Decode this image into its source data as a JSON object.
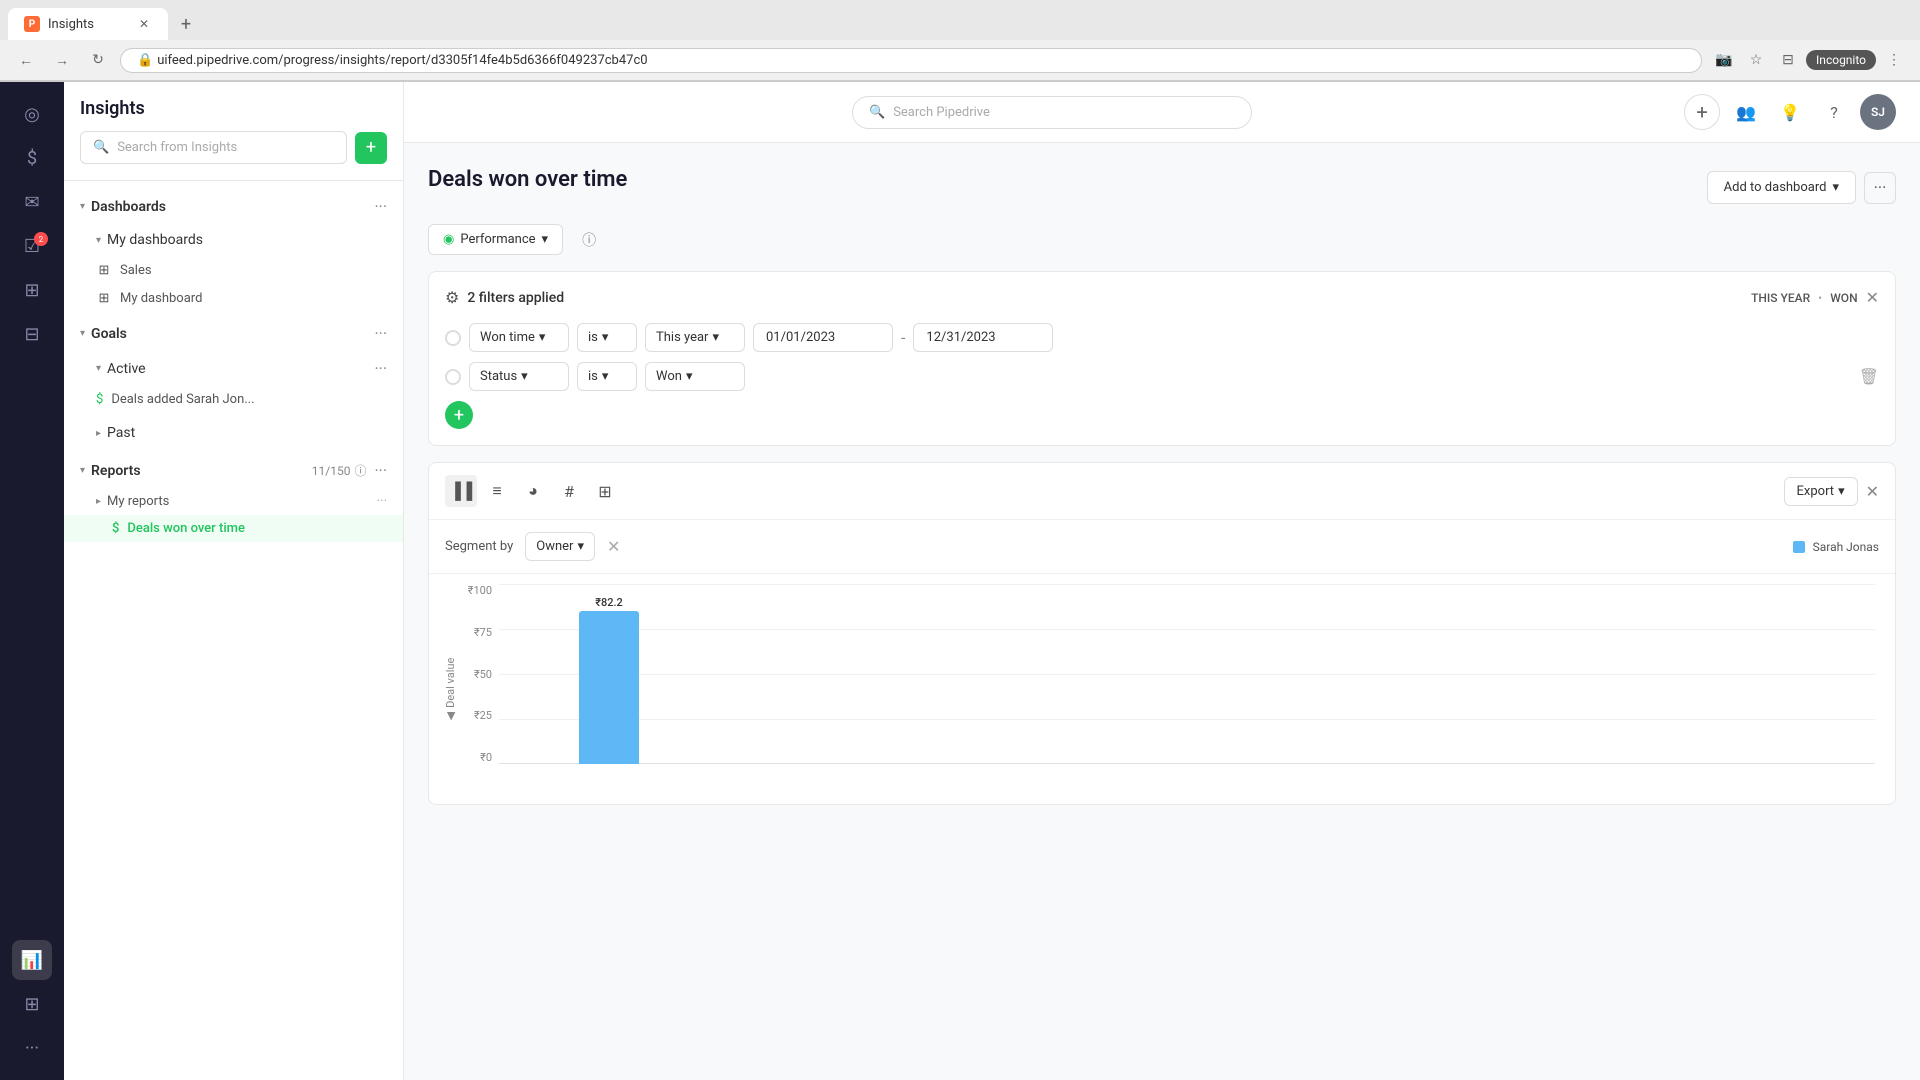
{
  "browser": {
    "tab_title": "Insights",
    "tab_favicon": "P",
    "url": "uifeed.pipedrive.com/progress/insights/report/d3305f14fe4b5d6366f049237cb47c0",
    "new_tab_label": "+",
    "incognito_label": "Incognito"
  },
  "header": {
    "app_title": "Insights",
    "search_placeholder": "Search Pipedrive",
    "add_label": "+",
    "avatar_label": "SJ"
  },
  "sidebar": {
    "search_placeholder": "Search from Insights",
    "add_btn_label": "+",
    "dashboards_label": "Dashboards",
    "my_dashboards_label": "My dashboards",
    "sales_label": "Sales",
    "my_dashboard_label": "My dashboard",
    "goals_label": "Goals",
    "active_label": "Active",
    "deals_added_label": "Deals added Sarah Jon...",
    "past_label": "Past",
    "reports_label": "Reports",
    "reports_count": "11/150",
    "my_reports_label": "My reports",
    "deals_won_label": "Deals won over time"
  },
  "report": {
    "title": "Deals won over time",
    "add_dashboard_label": "Add to dashboard",
    "more_label": "···"
  },
  "performance_btn": {
    "label": "Performance"
  },
  "filters": {
    "title": "2 filters applied",
    "tag1": "THIS YEAR",
    "tag2": "WON",
    "filter1": {
      "field": "Won time",
      "operator": "is",
      "period": "This year",
      "date_from": "01/01/2023",
      "date_to": "12/31/2023"
    },
    "filter2": {
      "field": "Status",
      "operator": "is",
      "value": "Won"
    }
  },
  "chart": {
    "export_label": "Export",
    "segment_label": "Segment by",
    "segment_value": "Owner",
    "y_labels": [
      "₹100",
      "₹75",
      "₹50",
      "₹25",
      "₹0"
    ],
    "y_axis_title": "Deal value",
    "bar_value": "₹82.2",
    "bar_height_pct": 82,
    "legend": {
      "color": "#5db8f5",
      "label": "Sarah Jonas"
    }
  },
  "icons": {
    "target": "◎",
    "dollar": "$",
    "mail": "✉",
    "chart_bar": "📊",
    "activity": "☑",
    "grid": "⊞",
    "more_dots": "···",
    "chevron_down": "▾",
    "chevron_right": "▸",
    "filter": "⚙",
    "bar_chart": "▐▐",
    "list": "≡",
    "pie": "◕",
    "hash": "#",
    "table": "⊞",
    "people": "👥",
    "bulb": "💡",
    "question": "?",
    "shield": "🔒",
    "apps": "⊞",
    "settings": "⚙",
    "refresh": "↻",
    "back": "←",
    "forward": "→",
    "search": "🔍",
    "star": "★",
    "profile": "👤",
    "camera": "📷",
    "mute": "🔇",
    "delete": "🗑",
    "plus": "+",
    "close": "✕",
    "arrow_right": "▶",
    "arrow_left": "◀",
    "dropdown": "▾",
    "grid2": "⊟",
    "dollar_circle": "$",
    "goals_icon": "◉",
    "reports_icon": "▣"
  }
}
